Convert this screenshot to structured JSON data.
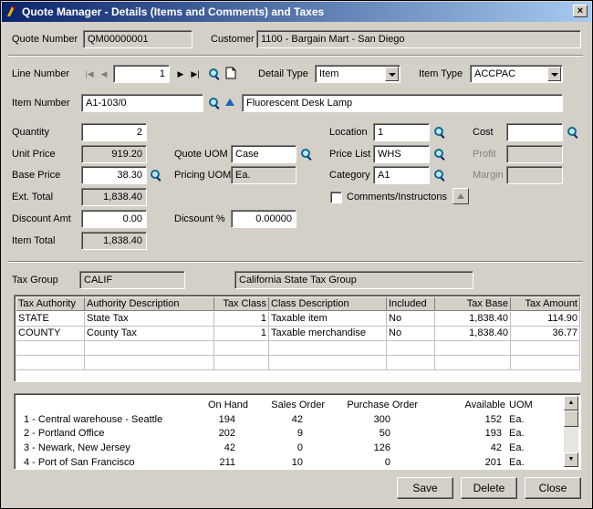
{
  "window": {
    "title": "Quote Manager - Details (Items and Comments) and Taxes",
    "close": "×"
  },
  "header": {
    "quote_number_label": "Quote Number",
    "quote_number": "QM00000001",
    "customer_label": "Customer",
    "customer": "1100 - Bargain Mart - San Diego"
  },
  "line": {
    "line_number_label": "Line Number",
    "line_number": "1",
    "detail_type_label": "Detail Type",
    "detail_type": "Item",
    "item_type_label": "Item Type",
    "item_type": "ACCPAC",
    "item_number_label": "Item Number",
    "item_number": "A1-103/0",
    "item_description": "Fluorescent Desk Lamp"
  },
  "pricing": {
    "quantity_label": "Quantity",
    "quantity": "2",
    "unit_price_label": "Unit Price",
    "unit_price": "919.20",
    "base_price_label": "Base Price",
    "base_price": "38.30",
    "ext_total_label": "Ext. Total",
    "ext_total": "1,838.40",
    "discount_amt_label": "Discount Amt",
    "discount_amt": "0.00",
    "item_total_label": "Item Total",
    "item_total": "1,838.40",
    "quote_uom_label": "Quote UOM",
    "quote_uom": "Case",
    "pricing_uom_label": "Pricing UOM",
    "pricing_uom": "Ea.",
    "discount_pct_label": "Dicsount %",
    "discount_pct": "0.00000",
    "location_label": "Location",
    "location": "1",
    "price_list_label": "Price List",
    "price_list": "WHS",
    "category_label": "Category",
    "category": "A1",
    "comments_label": "Comments/Instructons",
    "cost_label": "Cost",
    "cost": "",
    "profit_label": "Profit",
    "profit": "",
    "margin_label": "Margin",
    "margin": ""
  },
  "tax": {
    "group_label": "Tax Group",
    "group": "CALIF",
    "group_description": "California State Tax Group",
    "columns": [
      "Tax Authority",
      "Authority Description",
      "Tax Class",
      "Class Description",
      "Included",
      "Tax Base",
      "Tax Amount"
    ],
    "rows": [
      [
        "STATE",
        "State Tax",
        "1",
        "Taxable item",
        "No",
        "1,838.40",
        "114.90"
      ],
      [
        "COUNTY",
        "County Tax",
        "1",
        "Taxable merchandise",
        "No",
        "1,838.40",
        "36.77"
      ]
    ]
  },
  "inventory": {
    "columns": [
      "On Hand",
      "Sales Order",
      "Purchase Order",
      "Available",
      "UOM"
    ],
    "rows": [
      [
        "1 - Central warehouse - Seattle",
        "194",
        "42",
        "300",
        "152",
        "Ea."
      ],
      [
        "2 - Portland Office",
        "202",
        "9",
        "50",
        "193",
        "Ea."
      ],
      [
        "3 - Newark, New Jersey",
        "42",
        "0",
        "126",
        "42",
        "Ea."
      ],
      [
        "4 - Port of San Francisco",
        "211",
        "10",
        "0",
        "201",
        "Ea."
      ]
    ]
  },
  "buttons": {
    "save": "Save",
    "delete": "Delete",
    "close": "Close"
  }
}
